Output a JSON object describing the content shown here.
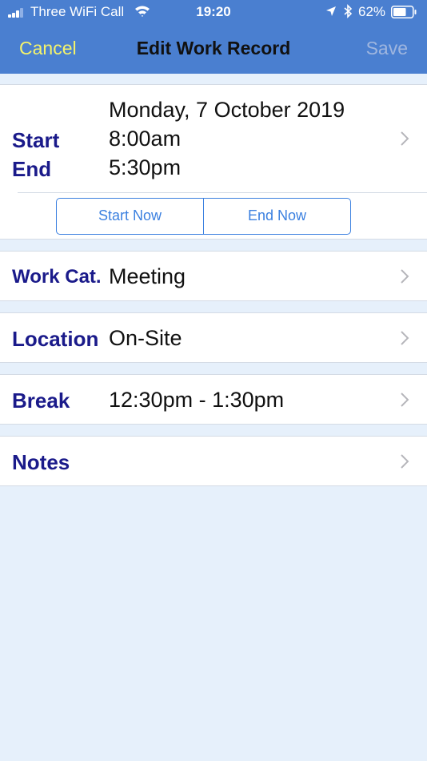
{
  "status_bar": {
    "carrier": "Three WiFi Call",
    "time": "19:20",
    "battery": "62%"
  },
  "nav": {
    "cancel": "Cancel",
    "title": "Edit Work Record",
    "save": "Save"
  },
  "time_section": {
    "date": "Monday, 7 October 2019",
    "start_label": "Start",
    "start_value": "8:00am",
    "end_label": "End",
    "end_value": "5:30pm",
    "start_now": "Start Now",
    "end_now": "End Now"
  },
  "work_category": {
    "label": "Work Cat.",
    "value": "Meeting"
  },
  "location": {
    "label": "Location",
    "value": "On-Site"
  },
  "break": {
    "label": "Break",
    "value": "12:30pm - 1:30pm"
  },
  "notes": {
    "label": "Notes"
  },
  "colors": {
    "nav_bar": "#4a7fd0",
    "cancel": "#f4f36b",
    "label": "#1a1a8a",
    "button": "#3b80e0",
    "background": "#e6f0fb"
  },
  "icons": [
    "signal-icon",
    "wifi-icon",
    "location-arrow-icon",
    "bluetooth-icon",
    "battery-icon",
    "chevron-right-icon"
  ]
}
